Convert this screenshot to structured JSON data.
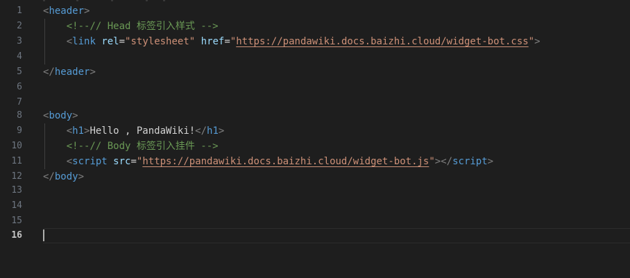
{
  "editor": {
    "language": "html",
    "active_line": "16",
    "lines": [
      {
        "number": "1"
      },
      {
        "number": "2"
      },
      {
        "number": "3"
      },
      {
        "number": "4"
      },
      {
        "number": "5"
      },
      {
        "number": "6"
      },
      {
        "number": "7"
      },
      {
        "number": "8"
      },
      {
        "number": "9"
      },
      {
        "number": "10"
      },
      {
        "number": "11"
      },
      {
        "number": "12"
      },
      {
        "number": "13"
      },
      {
        "number": "14"
      },
      {
        "number": "15"
      },
      {
        "number": "16"
      }
    ],
    "tokens": {
      "header_open": "header",
      "header_close": "header",
      "head_comment": "<!--// Head 标签引入样式 -->",
      "link_tag": "link",
      "link_rel_attr": "rel",
      "link_rel_value": "\"stylesheet\"",
      "link_href_attr": "href",
      "link_href_value": "https://pandawiki.docs.baizhi.cloud/widget-bot.css",
      "body_open": "body",
      "body_close": "body",
      "h1_tag": "h1",
      "h1_text": "Hello , PandaWiki!",
      "body_comment": "<!--// Body 标签引入挂件 -->",
      "script_tag": "script",
      "script_src_attr": "src",
      "script_src_value": "https://pandawiki.docs.baizhi.cloud/widget-bot.js"
    }
  },
  "colors": {
    "background": "#1e1e1e",
    "tag": "#569cd6",
    "attribute": "#9cdcfe",
    "string": "#ce9178",
    "comment": "#6a9955",
    "punctuation": "#808080",
    "line_number": "#6e7681"
  }
}
